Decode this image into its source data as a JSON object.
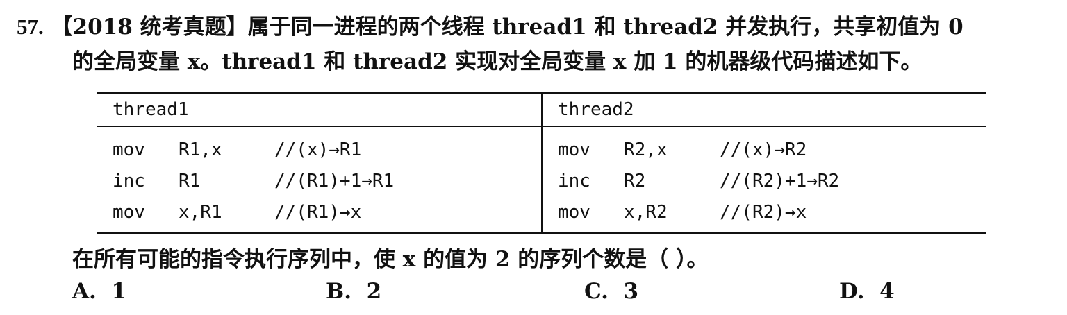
{
  "question": {
    "number": "57.",
    "line1": "【2018 统考真题】属于同一进程的两个线程 thread1 和 thread2 并发执行，共享初值为 0",
    "line2": "的全局变量 x。thread1 和 thread2 实现对全局变量 x 加 1 的机器级代码描述如下。"
  },
  "code_table": {
    "headers": [
      "thread1",
      "thread2"
    ],
    "rows": [
      {
        "t1": {
          "op": "mov",
          "args": "R1,x",
          "comment": "//(x)→R1"
        },
        "t2": {
          "op": "mov",
          "args": "R2,x",
          "comment": "//(x)→R2"
        }
      },
      {
        "t1": {
          "op": "inc",
          "args": "R1",
          "comment": "//(R1)+1→R1"
        },
        "t2": {
          "op": "inc",
          "args": "R2",
          "comment": "//(R2)+1→R2"
        }
      },
      {
        "t1": {
          "op": "mov",
          "args": "x,R1",
          "comment": "//(R1)→x"
        },
        "t2": {
          "op": "mov",
          "args": "x,R2",
          "comment": "//(R2)→x"
        }
      }
    ]
  },
  "prompt": "在所有可能的指令执行序列中，使 x 的值为 2 的序列个数是（ ）。",
  "options": [
    {
      "label": "A.",
      "value": "1"
    },
    {
      "label": "B.",
      "value": "2"
    },
    {
      "label": "C.",
      "value": "3"
    },
    {
      "label": "D.",
      "value": "4"
    }
  ]
}
